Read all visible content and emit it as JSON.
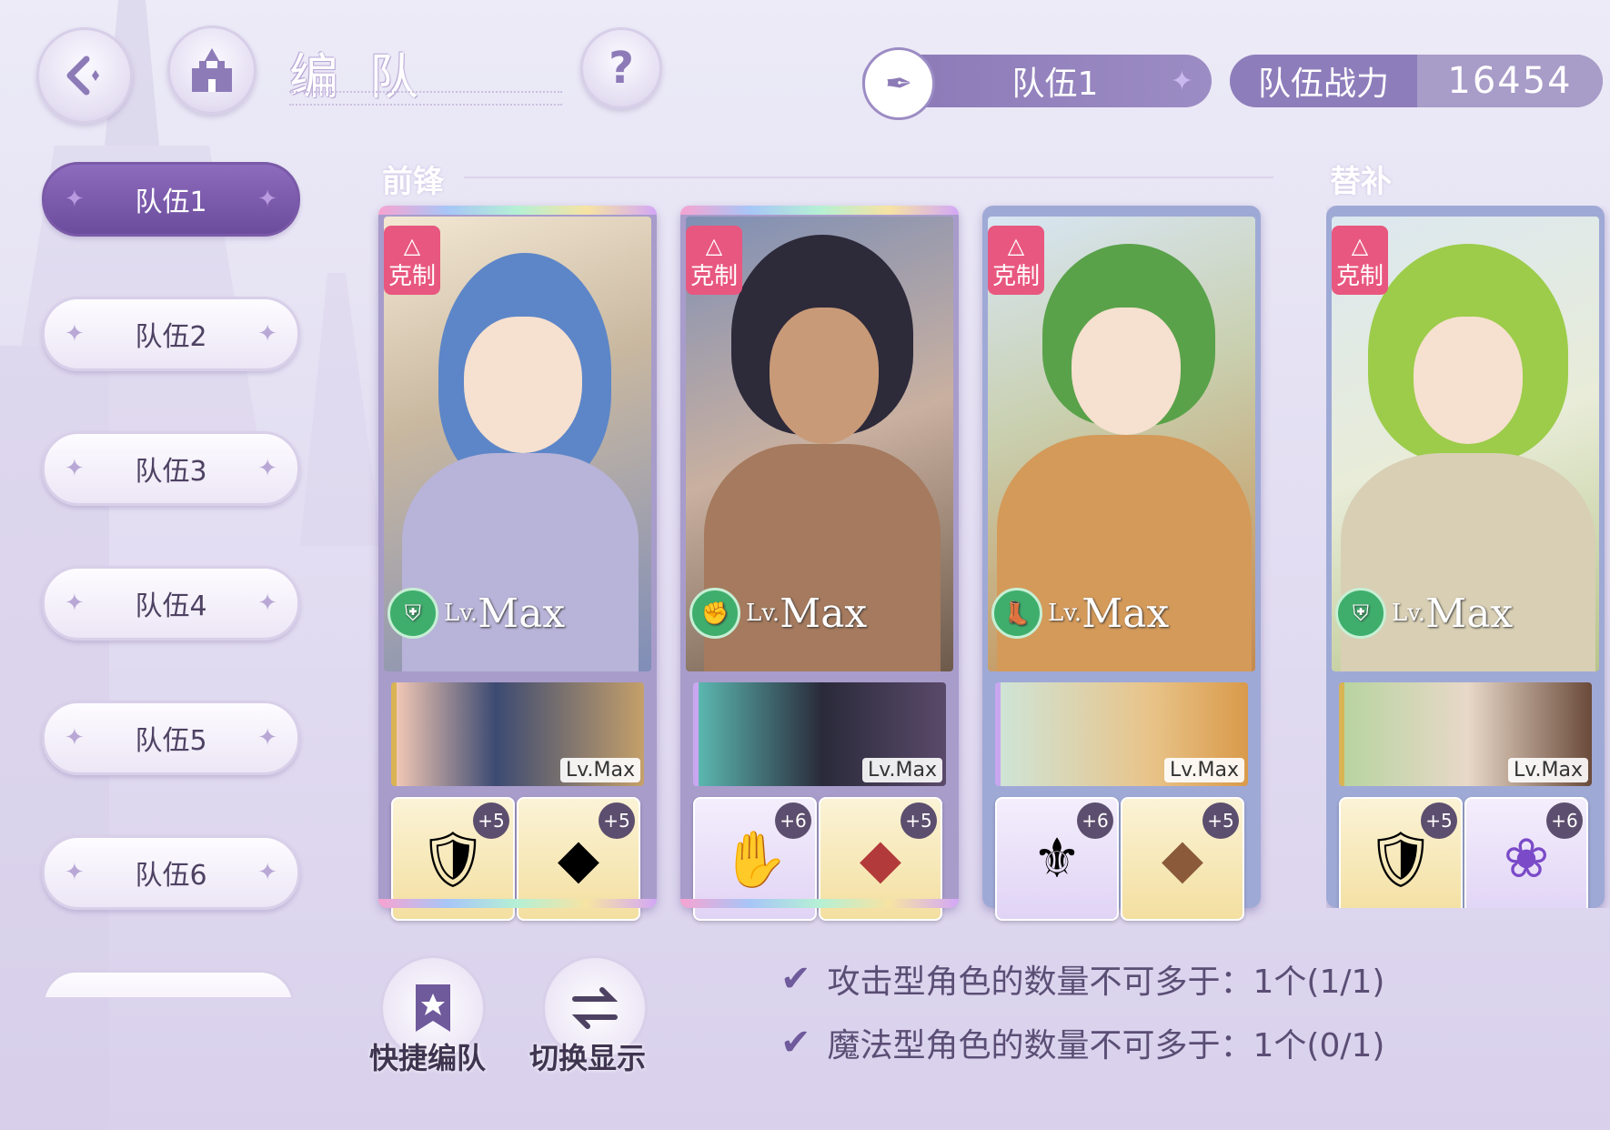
{
  "header": {
    "title": "编队",
    "help_label": "?",
    "team_select_label": "队伍1",
    "power_label": "队伍战力",
    "power_value": "16454"
  },
  "sidebar": {
    "tabs": [
      {
        "label": "队伍1",
        "active": true
      },
      {
        "label": "队伍2",
        "active": false
      },
      {
        "label": "队伍3",
        "active": false
      },
      {
        "label": "队伍4",
        "active": false
      },
      {
        "label": "队伍5",
        "active": false
      },
      {
        "label": "队伍6",
        "active": false
      }
    ]
  },
  "sections": {
    "front_label": "前锋",
    "sub_label": "替补"
  },
  "cards": [
    {
      "badge": "克制",
      "lv_prefix": "Lv.",
      "lv": "Max",
      "support_lv": "Lv.Max",
      "equip1_plus": "+5",
      "equip2_plus": "+5",
      "role_icon": "shield-icon"
    },
    {
      "badge": "克制",
      "lv_prefix": "Lv.",
      "lv": "Max",
      "support_lv": "Lv.Max",
      "equip1_plus": "+6",
      "equip2_plus": "+5",
      "role_icon": "fist-icon"
    },
    {
      "badge": "克制",
      "lv_prefix": "Lv.",
      "lv": "Max",
      "support_lv": "Lv.Max",
      "equip1_plus": "+6",
      "equip2_plus": "+5",
      "role_icon": "boot-icon"
    },
    {
      "badge": "克制",
      "lv_prefix": "Lv.",
      "lv": "Max",
      "support_lv": "Lv.Max",
      "equip1_plus": "+5",
      "equip2_plus": "+6",
      "role_icon": "shield-icon"
    }
  ],
  "bottom": {
    "quick_label": "快捷编队",
    "switch_label": "切换显示",
    "rules": [
      "攻击型角色的数量不可多于：1个(1/1)",
      "魔法型角色的数量不可多于：1个(0/1)"
    ]
  },
  "colors": {
    "accent": "#7a5aa8",
    "badge": "#e8577f",
    "role": "#3fae6d"
  }
}
